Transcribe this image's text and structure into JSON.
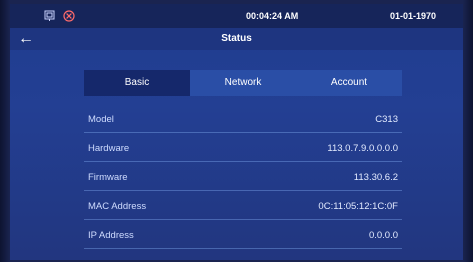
{
  "statusbar": {
    "time": "00:04:24   AM",
    "date": "01-01-1970",
    "icons": [
      "network-status-icon",
      "alert-x-icon"
    ]
  },
  "header": {
    "back_icon": "left-arrow-icon",
    "title": "Status"
  },
  "tabs": [
    {
      "label": "Basic",
      "active": true
    },
    {
      "label": "Network",
      "active": false
    },
    {
      "label": "Account",
      "active": false
    }
  ],
  "info_rows": [
    {
      "label": "Model",
      "value": "C313"
    },
    {
      "label": "Hardware",
      "value": "113.0.7.9.0.0.0.0"
    },
    {
      "label": "Firmware",
      "value": "113.30.6.2"
    },
    {
      "label": "MAC Address",
      "value": "0C:11:05:12:1C:0F"
    },
    {
      "label": "IP Address",
      "value": "0.0.0.0"
    }
  ]
}
